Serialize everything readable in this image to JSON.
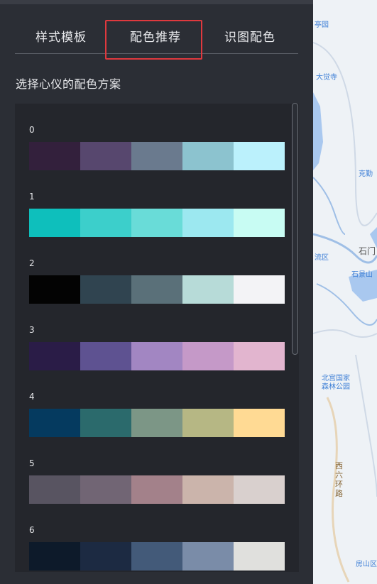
{
  "tabs": [
    {
      "label": "样式模板"
    },
    {
      "label": "配色推荐"
    },
    {
      "label": "识图配色"
    }
  ],
  "active_tab": "配色推荐",
  "section_title": "选择心仪的配色方案",
  "schemes": [
    {
      "index": "0",
      "colors": [
        "#33203c",
        "#57476e",
        "#6a7a8e",
        "#8cc3cf",
        "#bbf1fc"
      ]
    },
    {
      "index": "1",
      "colors": [
        "#0ebfbc",
        "#3ccfcb",
        "#69dcd8",
        "#9ce8f0",
        "#c8fcf3"
      ]
    },
    {
      "index": "2",
      "colors": [
        "#030303",
        "#304450",
        "#5a7079",
        "#b7dbd8",
        "#f3f3f6"
      ]
    },
    {
      "index": "3",
      "colors": [
        "#2a1c47",
        "#5e5291",
        "#a286c2",
        "#c599c8",
        "#e2b5cf"
      ]
    },
    {
      "index": "4",
      "colors": [
        "#053a5f",
        "#2b6a6c",
        "#7c9686",
        "#b6b784",
        "#ffda94"
      ]
    },
    {
      "index": "5",
      "colors": [
        "#585461",
        "#716574",
        "#a3818a",
        "#cbb4ab",
        "#d9d0ce"
      ]
    },
    {
      "index": "6",
      "colors": [
        "#0d1a2a",
        "#1c2a42",
        "#435a79",
        "#7a8ca8",
        "#e0e0dd"
      ]
    }
  ],
  "map_labels": [
    "亭园",
    "大觉寺",
    "克勤",
    "石门",
    "流区",
    "石景山",
    "北宫国家森林公园",
    "西六环路",
    "房山区"
  ]
}
